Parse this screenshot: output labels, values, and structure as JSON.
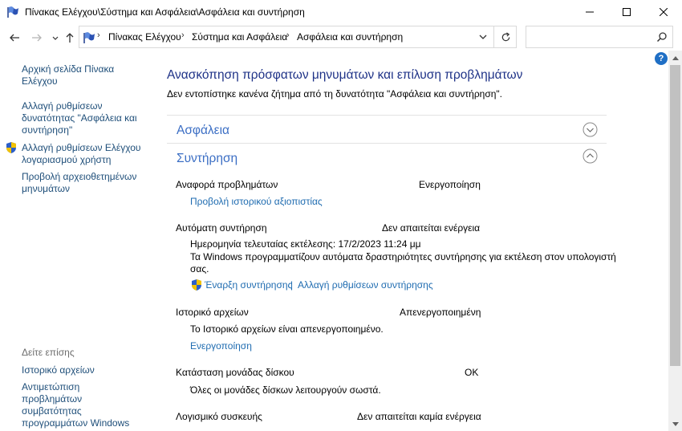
{
  "window": {
    "title": "Πίνακας Ελέγχου\\Σύστημα και Ασφάλεια\\Ασφάλεια και συντήρηση"
  },
  "address": {
    "crumbs": [
      "Πίνακας Ελέγχου",
      "Σύστημα και Ασφάλεια",
      "Ασφάλεια και συντήρηση"
    ]
  },
  "search": {
    "placeholder": ""
  },
  "help": {
    "label": "?"
  },
  "sidebar": {
    "home_line1": "Αρχική σελίδα Πίνακα",
    "home_line2": "Ελέγχου",
    "change_settings_line1": "Αλλαγή ρυθμίσεων",
    "change_settings_line2": "δυνατότητας \"Ασφάλεια και",
    "change_settings_line3": "συντήρηση\"",
    "uac_line1": "Αλλαγή ρυθμίσεων Ελέγχου",
    "uac_line2": "λογαριασμού χρήστη",
    "archived_line1": "Προβολή αρχειοθετημένων",
    "archived_line2": "μηνυμάτων",
    "see_also": "Δείτε επίσης",
    "file_history": "Ιστορικό αρχείων",
    "compat_line1": "Αντιμετώπιση προβλημάτων",
    "compat_line2": "συμβατότητας",
    "compat_line3": "προγραμμάτων Windows"
  },
  "main": {
    "heading": "Ανασκόπηση πρόσφατων μηνυμάτων και επίλυση προβλημάτων",
    "subtitle": "Δεν εντοπίστηκε κανένα ζήτημα από τη δυνατότητα \"Ασφάλεια και συντήρηση\".",
    "security_title": "Ασφάλεια",
    "maintenance_title": "Συντήρηση",
    "problem_reporting": {
      "label": "Αναφορά προβλημάτων",
      "status": "Ενεργοποίηση",
      "link": "Προβολή ιστορικού αξιοπιστίας"
    },
    "auto_maintenance": {
      "label": "Αυτόματη συντήρηση",
      "status": "Δεν απαιτείται ενέργεια",
      "last_run": "Ημερομηνία τελευταίας εκτέλεσης: 17/2/2023 11:24 μμ",
      "desc_line1": "Τα Windows προγραμματίζουν αυτόματα δραστηριότητες συντήρησης για εκτέλεση στον υπολογιστή",
      "desc_line2": "σας.",
      "start_link": "Έναρξη συντήρησης",
      "separator": "|",
      "change_link": "Αλλαγή ρυθμίσεων συντήρησης"
    },
    "file_history": {
      "label": "Ιστορικό αρχείων",
      "status": "Απενεργοποιημένη",
      "desc": "Το Ιστορικό αρχείων είναι απενεργοποιημένο.",
      "link": "Ενεργοποίηση"
    },
    "drive_status": {
      "label": "Κατάσταση μονάδας δίσκου",
      "status": "OK",
      "desc": "Όλες οι μονάδες δίσκων λειτουργούν σωστά."
    },
    "device_software": {
      "label": "Λογισμικό συσκευής",
      "status": "Δεν απαιτείται καμία ενέργεια"
    }
  },
  "colors": {
    "heading": "#1e3287",
    "section": "#3b6ec4",
    "link": "#1e6bb0",
    "sidebar_link": "#1e4e79"
  }
}
